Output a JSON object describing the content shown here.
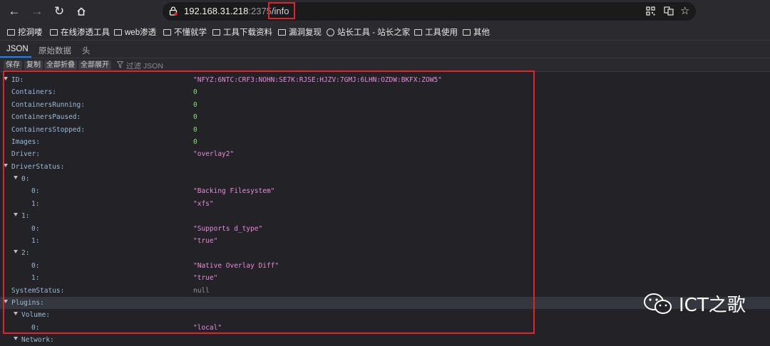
{
  "browser": {
    "url": {
      "host": "192.168.31.218",
      "port": ":2375",
      "path": "/info"
    },
    "bookmarks": [
      "挖洞喽",
      "在线渗透工具",
      "web渗透",
      "不懂就学",
      "工具下载资料",
      "漏洞复现",
      "站长工具 - 站长之家",
      "工具使用",
      "其他"
    ]
  },
  "viewer": {
    "tabs": [
      "JSON",
      "原始数据",
      "头"
    ],
    "toolbar": {
      "save": "保存",
      "copy": "复制",
      "collapse_all": "全部折叠",
      "expand_all": "全部展开",
      "filter_placeholder": "过滤 JSON"
    }
  },
  "json_rows": [
    {
      "key": "ID:",
      "value": "\"NFYZ:6NTC:CRF3:NOHN:SE7K:RJSE:HJZV:7GMJ:6LHN:OZDW:BKFX:ZOW5\"",
      "type": "string"
    },
    {
      "key": "Containers:",
      "value": "0",
      "type": "number"
    },
    {
      "key": "ContainersRunning:",
      "value": "0",
      "type": "number"
    },
    {
      "key": "ContainersPaused:",
      "value": "0",
      "type": "number"
    },
    {
      "key": "ContainersStopped:",
      "value": "0",
      "type": "number"
    },
    {
      "key": "Images:",
      "value": "0",
      "type": "number"
    },
    {
      "key": "Driver:",
      "value": "\"overlay2\"",
      "type": "string"
    },
    {
      "key": "DriverStatus:",
      "value": "",
      "type": "object"
    },
    {
      "key": "0:",
      "value": "",
      "type": "object"
    },
    {
      "key": "0:",
      "value": "\"Backing Filesystem\"",
      "type": "string"
    },
    {
      "key": "1:",
      "value": "\"xfs\"",
      "type": "string"
    },
    {
      "key": "1:",
      "value": "",
      "type": "object"
    },
    {
      "key": "0:",
      "value": "\"Supports d_type\"",
      "type": "string"
    },
    {
      "key": "1:",
      "value": "\"true\"",
      "type": "string"
    },
    {
      "key": "2:",
      "value": "",
      "type": "object"
    },
    {
      "key": "0:",
      "value": "\"Native Overlay Diff\"",
      "type": "string"
    },
    {
      "key": "1:",
      "value": "\"true\"",
      "type": "string"
    },
    {
      "key": "SystemStatus:",
      "value": "null",
      "type": "null"
    },
    {
      "key": "Plugins:",
      "value": "",
      "type": "object"
    },
    {
      "key": "Volume:",
      "value": "",
      "type": "object"
    },
    {
      "key": "0:",
      "value": "\"local\"",
      "type": "string"
    },
    {
      "key": "Network:",
      "value": "",
      "type": "object"
    }
  ],
  "watermark": {
    "text": "ICT之歌"
  },
  "colors": {
    "string": "#e48cd8",
    "number": "#86de74",
    "null": "#939395",
    "key": "#9bbad6",
    "highlight": "#e1242b"
  }
}
